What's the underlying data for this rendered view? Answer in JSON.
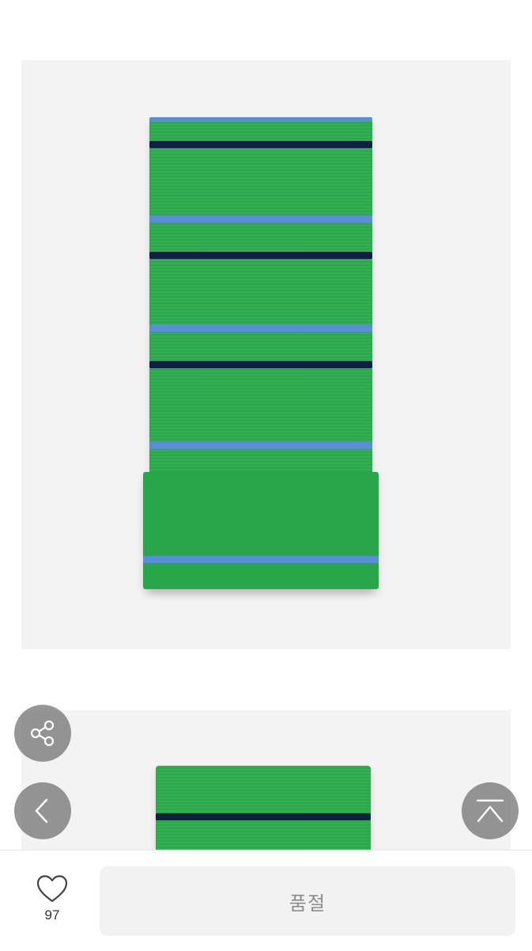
{
  "product": {
    "like_count": "97",
    "status_button_label": "품절"
  },
  "icons": {
    "share": "share-icon",
    "back": "chevron-left-icon",
    "scroll_top": "scroll-to-top-icon",
    "like": "heart-icon"
  },
  "colors": {
    "scarf_green": "#2eac4e",
    "stripe_navy": "#0e2140",
    "stripe_blue": "#5a8fd6",
    "photo_background": "#f3f3f3",
    "soldout_button_background": "#f2f2f2",
    "soldout_button_text": "#8c8c8c"
  }
}
